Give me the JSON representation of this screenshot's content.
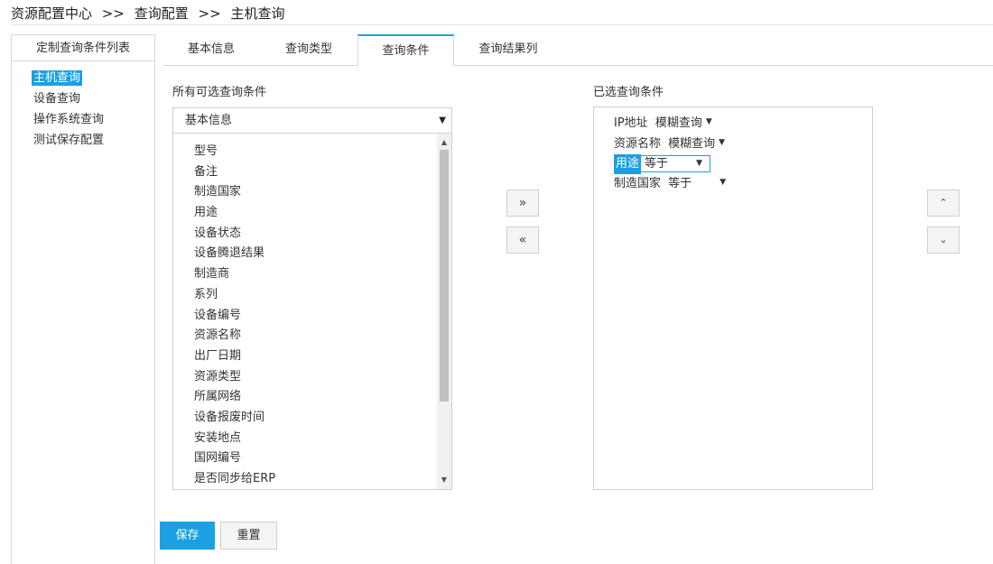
{
  "breadcrumb": {
    "items": [
      "资源配置中心",
      "查询配置",
      "主机查询"
    ],
    "separator": ">>"
  },
  "left_panel": {
    "title": "定制查询条件列表",
    "items": [
      {
        "label": "主机查询",
        "active": true
      },
      {
        "label": "设备查询",
        "active": false
      },
      {
        "label": "操作系统查询",
        "active": false
      },
      {
        "label": "测试保存配置",
        "active": false
      }
    ]
  },
  "tabs": [
    {
      "label": "基本信息",
      "active": false
    },
    {
      "label": "查询类型",
      "active": false
    },
    {
      "label": "查询条件",
      "active": true
    },
    {
      "label": "查询结果列",
      "active": false
    }
  ],
  "available": {
    "label": "所有可选查询条件",
    "category_select": "基本信息",
    "items": [
      "型号",
      "备注",
      "制造国家",
      "用途",
      "设备状态",
      "设备腾退结果",
      "制造商",
      "系列",
      "设备编号",
      "资源名称",
      "出厂日期",
      "资源类型",
      "所属网络",
      "设备报废时间",
      "安装地点",
      "国网编号",
      "是否同步给ERP"
    ]
  },
  "selected": {
    "label": "已选查询条件",
    "items": [
      {
        "field": "IP地址",
        "operator": "模糊查询",
        "active": false
      },
      {
        "field": "资源名称",
        "operator": "模糊查询",
        "active": false
      },
      {
        "field": "用途",
        "operator": "等于",
        "active": true
      },
      {
        "field": "制造国家",
        "operator": "等于",
        "active": false
      }
    ]
  },
  "buttons": {
    "add_all": "»",
    "remove_all": "«",
    "move_up": "⌃",
    "move_down": "⌄",
    "save": "保存",
    "reset": "重置"
  },
  "colors": {
    "accent": "#1ba0e1",
    "border": "#d8d8d8"
  }
}
